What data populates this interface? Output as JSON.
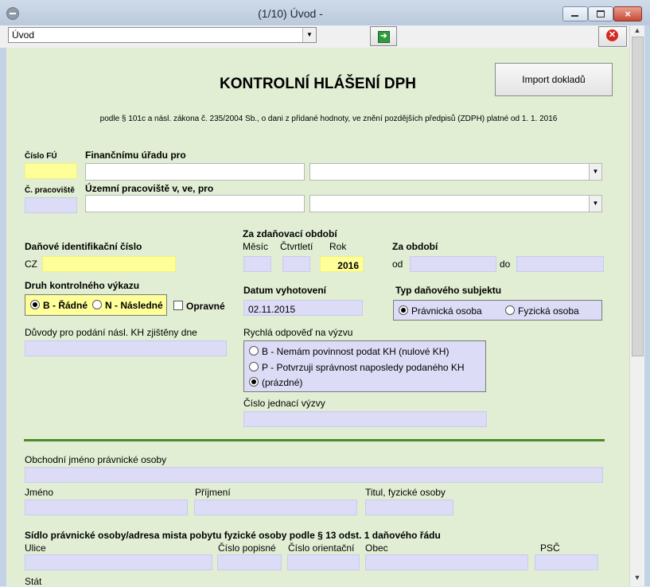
{
  "window": {
    "title": "(1/10) Úvod -"
  },
  "toolbar": {
    "nav_value": "Úvod"
  },
  "header": {
    "title": "KONTROLNÍ HLÁŠENÍ DPH",
    "subtitle": "podle § 101c a násl. zákona č. 235/2004 Sb., o dani z přidané hodnoty, ve znění pozdějších předpisů (ZDPH) platné od 1. 1. 2016",
    "import_label": "Import dokladů"
  },
  "office": {
    "cislo_fu_label": "Číslo FÚ",
    "urad_label": "Finančnímu úřadu pro",
    "pracoviste_num_label": "Č. pracoviště",
    "pracoviste_label": "Územní pracoviště v, ve, pro"
  },
  "tax": {
    "dic_label": "Daňové identifikační číslo",
    "dic_prefix": "CZ",
    "period_label": "Za zdaňovací období",
    "mesic_label": "Měsíc",
    "ctvrtleti_label": "Čtvrtletí",
    "rok_label": "Rok",
    "rok_value": "2016",
    "za_obdobi_label": "Za období",
    "od_label": "od",
    "do_label": "do"
  },
  "druh": {
    "label": "Druh kontrolného výkazu",
    "radne": "B - Řádné",
    "nasledne": "N - Následné",
    "opravne": "Opravné"
  },
  "datum": {
    "label": "Datum vyhotovení",
    "value": "02.11.2015"
  },
  "typ": {
    "label": "Typ daňového subjektu",
    "pravnicka": "Právnická osoba",
    "fyzicka": "Fyzická osoba"
  },
  "duvody": {
    "label": "Důvody pro podání násl. KH zjištěny dne"
  },
  "odpoved": {
    "label": "Rychlá odpověď na výzvu",
    "opt_b": "B - Nemám povinnost podat KH (nulové KH)",
    "opt_p": "P - Potvrzuji správnost naposledy podaného KH",
    "opt_empty": "(prázdné)",
    "cislo_label": "Číslo jednací výzvy"
  },
  "subject": {
    "obchodni_label": "Obchodní jméno právnické osoby",
    "jmeno_label": "Jméno",
    "prijmeni_label": "Příjmení",
    "titul_label": "Titul, fyzické osoby",
    "sidlo_label": "Sídlo právnické osoby/adresa mista pobytu fyzické osoby podle § 13 odst. 1 daňového řádu",
    "ulice_label": "Ulice",
    "popisne_label": "Číslo popisné",
    "orientacni_label": "Číslo orientační",
    "obec_label": "Obec",
    "psc_label": "PSČ",
    "stat_label": "Stát"
  }
}
